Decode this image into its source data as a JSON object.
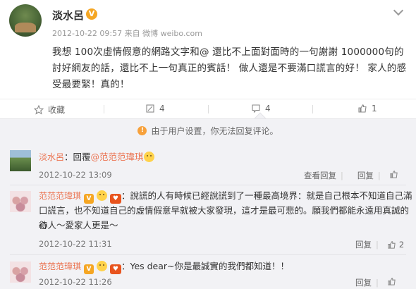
{
  "post": {
    "author": "淡水呂",
    "verified_badge": "V",
    "meta": "2012-10-22 09:57 来自 微博 weibo.com",
    "text": "我想 100次虛情假意的網路文字和@ 還比不上面對面時的一句謝謝 1000000句的討好網友的話，還比不上一句真正的賓話！ 做人還是不要滿口謊言的好！ 家人的感受最要緊！真的！"
  },
  "actions": {
    "favorite_label": "收藏",
    "repost_count": "4",
    "comment_count": "4",
    "like_count": "1"
  },
  "notice": {
    "text": "由于用户设置，你无法回复评论。",
    "icon": "!"
  },
  "comments": [
    {
      "name": "淡水呂",
      "reply_prefix": "：回覆",
      "mention": "@范范范瑋琪",
      "date": "2012-10-22 13:09",
      "view_replies": "查看回复",
      "reply": "回复",
      "like_count": ""
    },
    {
      "name": "范范范瑋琪",
      "badge": "V",
      "line1": "：說謊的人有時候已經說謊到了一種最高境界：就是自己根本不知道自己滿",
      "line2": "口謊言，也不知道自己的虛情假意早就被大家發現，這才是最可悲的。願我們都能永遠用真誠的心",
      "line3": "待人～愛家人更是～",
      "date": "2012-10-22 11:31",
      "reply": "回复",
      "like_count": "2"
    },
    {
      "name": "范范范瑋琪",
      "badge": "V",
      "text": "：Yes dear~你是最誠實的我們都知道！！",
      "date": "2012-10-22 11:26",
      "reply": "回复",
      "like_count": ""
    }
  ],
  "colors": {
    "accent": "#eb7350",
    "panel_bg": "#f2f2f5",
    "badge_orange": "#f5a623"
  }
}
